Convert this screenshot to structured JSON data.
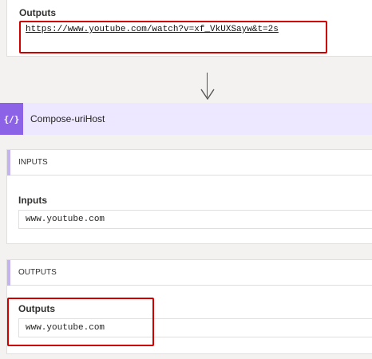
{
  "top_card": {
    "outputs_label": "Outputs",
    "outputs_value": "https://www.youtube.com/watch?v=xf_VkUXSayw&t=2s"
  },
  "action": {
    "icon": "compose-braces-icon",
    "icon_glyph": "{∕}",
    "title": "Compose-uriHost"
  },
  "inputs_section": {
    "title": "INPUTS",
    "field_label": "Inputs",
    "field_value": "www.youtube.com"
  },
  "outputs_section": {
    "title": "OUTPUTS",
    "field_label": "Outputs",
    "field_value": "www.youtube.com"
  },
  "colors": {
    "highlight": "#d00000",
    "action_accent": "#8c62e6",
    "header_bg": "#ede8ff"
  }
}
